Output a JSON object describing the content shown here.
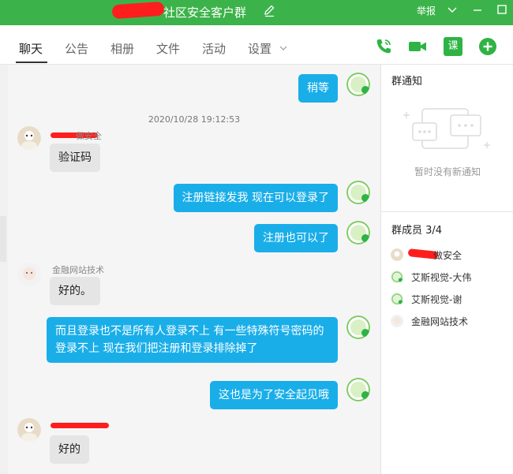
{
  "window": {
    "title": "社区安全客户群",
    "report_label": "举报",
    "title_bar_color": "#3cb34a"
  },
  "tabs": [
    {
      "label": "聊天",
      "active": true
    },
    {
      "label": "公告",
      "active": false
    },
    {
      "label": "相册",
      "active": false
    },
    {
      "label": "文件",
      "active": false
    },
    {
      "label": "活动",
      "active": false
    },
    {
      "label": "设置",
      "active": false
    }
  ],
  "toolbar": {
    "icons": [
      "phone-icon",
      "video-call-icon",
      "course-icon",
      "add-icon"
    ],
    "course_label": "课"
  },
  "chat": {
    "timestamp": "2020/10/28 19:12:53",
    "messages": [
      {
        "direction": "out",
        "text": "稍等"
      },
      {
        "direction": "in",
        "sender": "做安全",
        "text": "验证码"
      },
      {
        "direction": "out",
        "text": "注册链接发我   现在可以登录了"
      },
      {
        "direction": "out",
        "text": "注册也可以了"
      },
      {
        "direction": "in",
        "sender": "金融网站技术",
        "text": "好的。"
      },
      {
        "direction": "out",
        "text": "而且登录也不是所有人登录不上    有一些特殊符号密码的登录不上   现在我们把注册和登录排除掉了"
      },
      {
        "direction": "out",
        "text": "这也是为了安全起见哦"
      },
      {
        "direction": "in",
        "sender": "",
        "text": "好的"
      }
    ],
    "outgoing_bubble_color": "#1aaee9",
    "incoming_bubble_color": "#e5e5e5"
  },
  "sidebar": {
    "notice_title": "群通知",
    "notice_empty": "暂时没有新通知",
    "members_title": "群成员 3/4",
    "members": [
      {
        "name": "做安全"
      },
      {
        "name": "艾斯视觉-大伟"
      },
      {
        "name": "艾斯视觉-谢"
      },
      {
        "name": "金融网站技术"
      }
    ]
  }
}
